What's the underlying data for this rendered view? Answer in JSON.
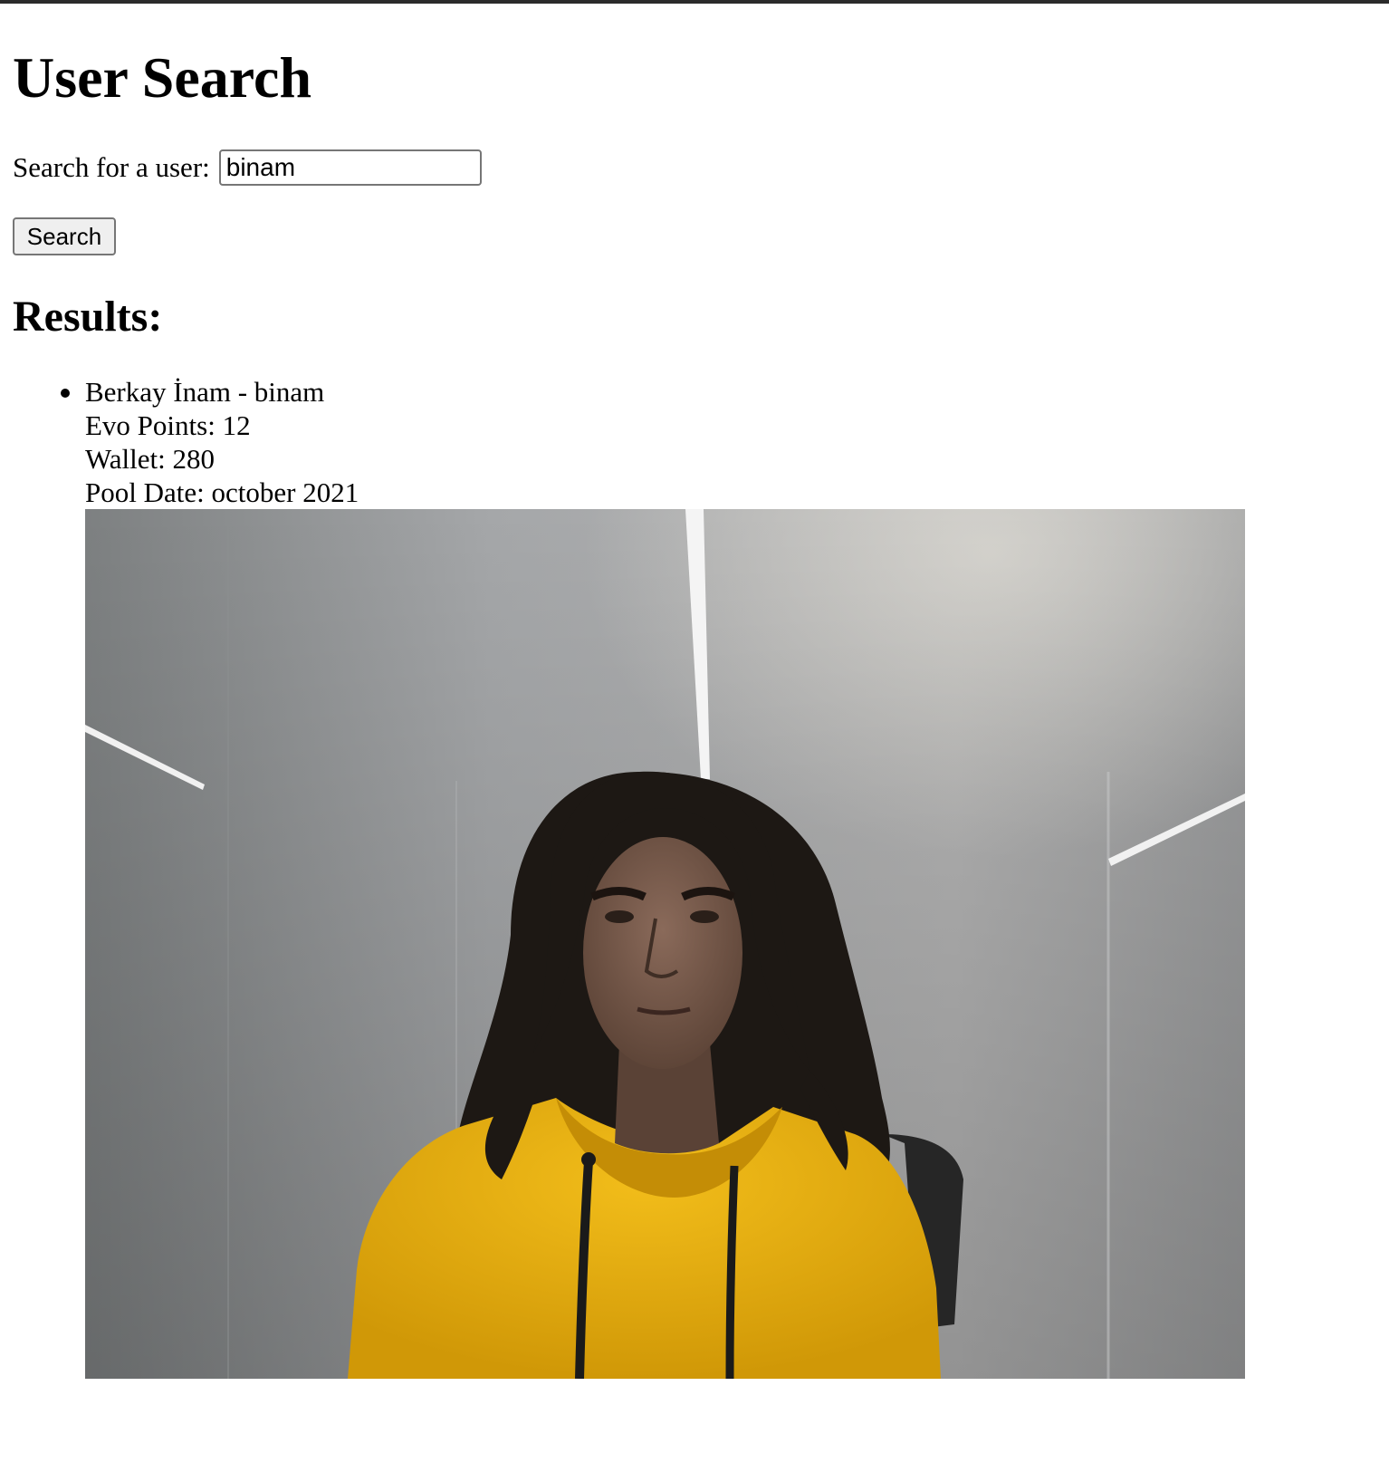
{
  "page": {
    "title": "User Search"
  },
  "search": {
    "label": "Search for a user:",
    "value": "binam",
    "button_label": "Search"
  },
  "results": {
    "heading": "Results:",
    "items": [
      {
        "name_line": "Berkay İnam - binam",
        "evo_points_line": "Evo Points: 12",
        "wallet_line": "Wallet: 280",
        "pool_date_line": "Pool Date: october 2021"
      }
    ]
  },
  "colors": {
    "hoodie": "#e8b010",
    "wall": "#a7a8aa",
    "hair": "#1d1814"
  }
}
